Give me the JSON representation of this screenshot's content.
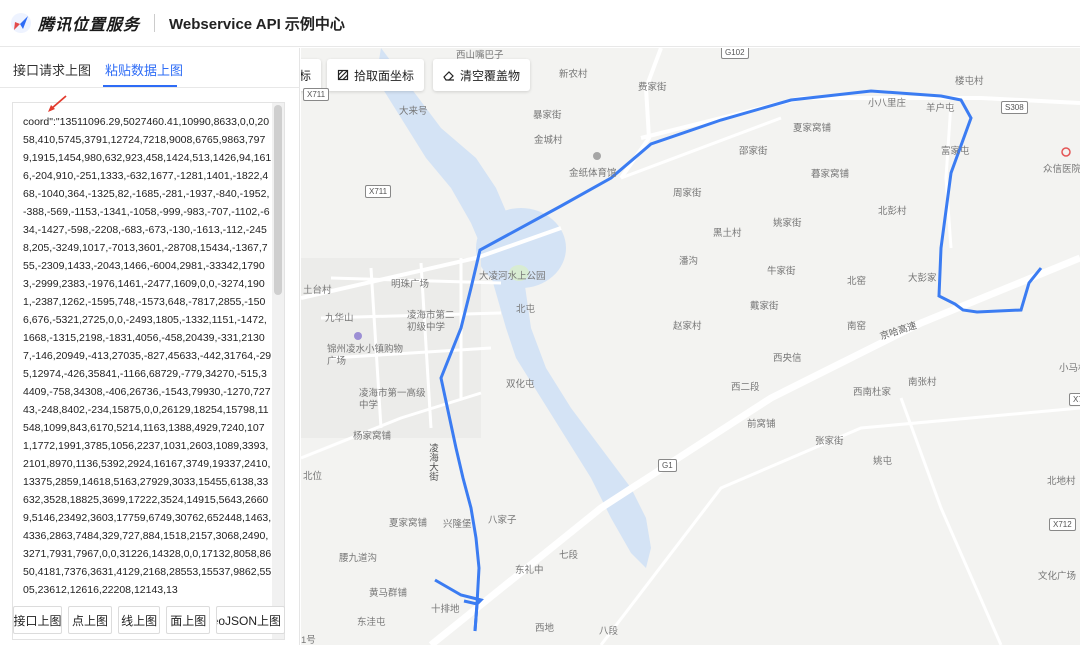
{
  "header": {
    "brand": "腾讯位置服务",
    "title": "Webservice API 示例中心"
  },
  "tabs": [
    {
      "label": "接口请求上图",
      "active": false
    },
    {
      "label": "粘贴数据上图",
      "active": true
    }
  ],
  "textarea": {
    "value": "coord\":\"13511096.29,5027460.41,10990,8633,0,0,2058,410,5745,3791,12724,7218,9008,6765,9863,7979,1915,1454,980,632,923,458,1424,513,1426,94,1616,-204,910,-251,1333,-632,1677,-1281,1401,-1822,468,-1040,364,-1325,82,-1685,-281,-1937,-840,-1952,-388,-569,-1153,-1341,-1058,-999,-983,-707,-1102,-634,-1427,-598,-2208,-683,-673,-130,-1613,-112,-2458,205,-3249,1017,-7013,3601,-28708,15434,-1367,755,-2309,1433,-2043,1466,-6004,2981,-33342,17903,-2999,2383,-1976,1461,-2477,1609,0,0,-3274,1901,-2387,1262,-1595,748,-1573,648,-7817,2855,-1506,676,-5321,2725,0,0,-2493,1805,-1332,1151,-1472,1668,-1315,2198,-1831,4056,-458,20439,-331,21307,-146,20949,-413,27035,-827,45633,-442,31764,-295,12974,-426,35841,-1166,68729,-779,34270,-515,34409,-758,34308,-406,26736,-1543,79930,-1270,72743,-248,8402,-234,15875,0,0,26129,18254,15798,11548,1099,843,6170,5214,1163,1388,4929,7240,1071,1772,1991,3785,1056,2237,1031,2603,1089,3393,2101,8970,1136,5392,2924,16167,3749,19337,2410,13375,2859,14618,5163,27929,3033,15455,6138,33632,3528,18825,3699,17222,3524,14915,5643,26609,5146,23492,3603,17759,6749,30762,652448,1463,4336,2863,7484,329,727,884,1518,2157,3068,2490,3271,7931,7967,0,0,31226,14328,0,0,17132,8058,8650,4181,7376,3631,4129,2168,28553,15537,9862,5505,23612,12616,22208,12143,13"
  },
  "buttons": {
    "api": "接口上图",
    "point": "点上图",
    "line": "线上图",
    "polygon": "面上图",
    "geojson": "GeoJSON上图"
  },
  "map_tools": {
    "partial": "标",
    "pick_polygon": "拾取面坐标",
    "clear": "清空覆盖物"
  },
  "map": {
    "route_color": "#3b7cf2",
    "road_badges": [
      "G102",
      "X711",
      "X711",
      "S308",
      "G1",
      "X712",
      "X7"
    ],
    "places": [
      "西山嘴巴子",
      "新农村",
      "费家街",
      "楼屯村",
      "大来号",
      "暴家街",
      "小八里庄",
      "羊户屯",
      "夏家窝铺",
      "金城村",
      "邵家街",
      "富家屯",
      "众信医院",
      "金纸体育馆",
      "暮家窝铺",
      "周家街",
      "北彭村",
      "姚家街",
      "黑土村",
      "大凌河水上公园",
      "明珠广场",
      "牛家街",
      "北窑",
      "大彭家",
      "潘沟",
      "土台村",
      "九华山",
      "北屯",
      "凌海市第二初级中学",
      "赵家村",
      "戴家街",
      "南窑",
      "锦州凌水小镇购物广场",
      "西央信",
      "京哈高速",
      "小马村",
      "双化屯",
      "西二段",
      "西南杜家",
      "南张村",
      "凌海市第一高级中学",
      "前窝铺",
      "杨家窝铺",
      "张家街",
      "凌海大街",
      "姚屯",
      "北位",
      "北地村",
      "夏家窝铺",
      "兴隆堡",
      "八家子",
      "腰九道沟",
      "七段",
      "东礼中",
      "文化广场",
      "黄马群铺",
      "东洼屯",
      "十排地",
      "西地",
      "八段",
      "1号"
    ]
  }
}
